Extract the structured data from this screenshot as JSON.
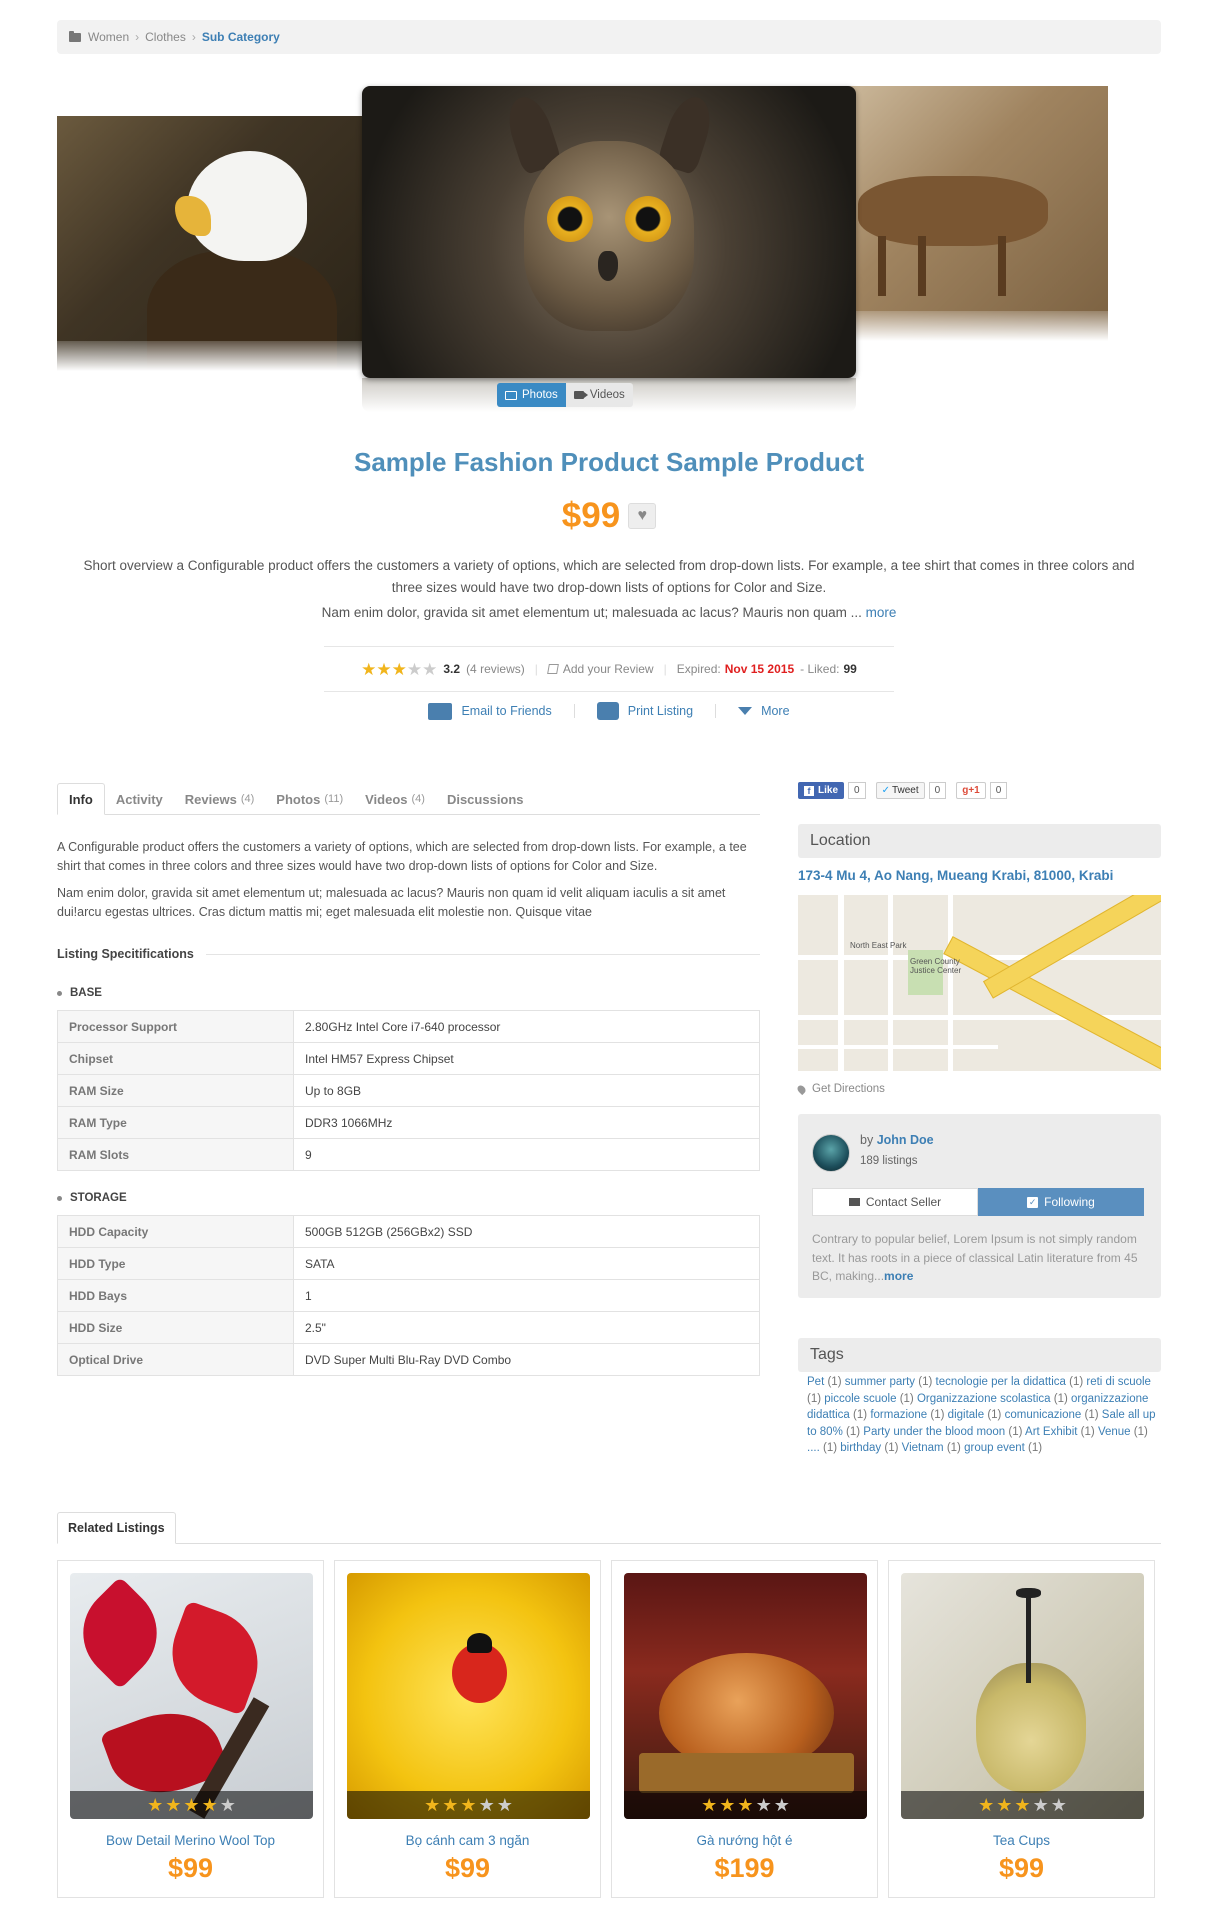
{
  "breadcrumb": {
    "items": [
      "Women",
      "Clothes"
    ],
    "current": "Sub Category"
  },
  "gallery": {
    "tabs": [
      {
        "label": "Photos",
        "icon": "photo-icon"
      },
      {
        "label": "Videos",
        "icon": "video-icon"
      }
    ]
  },
  "product": {
    "title": "Sample Fashion Product Sample Product",
    "price": "$99",
    "overview": "Short overview a Configurable product offers the customers a variety of options, which are selected from drop-down lists. For example, a tee shirt that comes in three colors and three sizes would have two drop-down lists of options for Color and Size.",
    "overview2": "Nam enim dolor, gravida sit amet elementum ut; malesuada ac lacus? Mauris non quam ... ",
    "more": "more",
    "rating": "3.2",
    "rating_stars": 3,
    "reviews": "(4 reviews)",
    "add_review": "Add your Review",
    "expired_label": "Expired:",
    "expired_date": "Nov 15 2015",
    "liked_label": "- Liked:",
    "liked": "99"
  },
  "actions": {
    "email": "Email to Friends",
    "print": "Print Listing",
    "more": "More"
  },
  "tabs": [
    {
      "label": "Info",
      "count": ""
    },
    {
      "label": "Activity",
      "count": ""
    },
    {
      "label": "Reviews",
      "count": "(4)"
    },
    {
      "label": "Photos",
      "count": "(11)"
    },
    {
      "label": "Videos",
      "count": "(4)"
    },
    {
      "label": "Discussions",
      "count": ""
    }
  ],
  "info": {
    "p1": "A Configurable product offers the customers a variety of options, which are selected from drop-down lists. For example, a tee shirt that comes in three colors and three sizes would have two drop-down lists of options for Color and Size.",
    "p2": "Nam enim dolor, gravida sit amet elementum ut; malesuada ac lacus? Mauris non quam id velit aliquam iaculis a sit amet dui!arcu egestas ultrices. Cras dictum mattis mi; eget malesuada elit molestie non. Quisque vitae"
  },
  "specs": {
    "title": "Listing Specitifications",
    "base_label": "BASE",
    "base": [
      {
        "k": "Processor Support",
        "v": "2.80GHz Intel Core i7-640 processor"
      },
      {
        "k": "Chipset",
        "v": "Intel HM57 Express Chipset"
      },
      {
        "k": "RAM Size",
        "v": "Up to 8GB"
      },
      {
        "k": "RAM Type",
        "v": "DDR3 1066MHz"
      },
      {
        "k": "RAM Slots",
        "v": "9"
      }
    ],
    "storage_label": "STORAGE",
    "storage": [
      {
        "k": "HDD Capacity",
        "v": "500GB 512GB (256GBx2) SSD"
      },
      {
        "k": "HDD Type",
        "v": "SATA"
      },
      {
        "k": "HDD Bays",
        "v": "1"
      },
      {
        "k": "HDD Size",
        "v": "2.5\""
      },
      {
        "k": "Optical Drive",
        "v": "DVD Super Multi Blu-Ray DVD Combo"
      }
    ]
  },
  "social": {
    "fb_label": "Like",
    "fb_count": "0",
    "tw_label": "Tweet",
    "tw_count": "0",
    "gp_label": "+1",
    "gp_count": "0"
  },
  "location": {
    "heading": "Location",
    "address": "173-4 Mu 4, Ao Nang, Mueang Krabi, 81000, Krabi",
    "directions": "Get Directions",
    "map_labels": [
      "North East Park",
      "Green County Justice Center"
    ]
  },
  "seller": {
    "by": "by",
    "name": "John Doe",
    "listings": "189 listings",
    "contact": "Contact Seller",
    "following": "Following",
    "desc": "Contrary to popular belief, Lorem Ipsum is not simply random text. It has roots in a piece of classical Latin literature from 45 BC, making...",
    "more": "more"
  },
  "tags": {
    "heading": "Tags",
    "items": [
      {
        "name": "Pet",
        "count": "(1)"
      },
      {
        "name": "summer party",
        "count": "(1)"
      },
      {
        "name": "tecnologie per la didattica",
        "count": "(1)"
      },
      {
        "name": "reti di scuole",
        "count": "(1)"
      },
      {
        "name": "piccole scuole",
        "count": "(1)"
      },
      {
        "name": "Organizzazione scolastica",
        "count": "(1)"
      },
      {
        "name": "organizzazione didattica",
        "count": "(1)"
      },
      {
        "name": "formazione",
        "count": "(1)"
      },
      {
        "name": "digitale",
        "count": "(1)"
      },
      {
        "name": "comunicazione",
        "count": "(1)"
      },
      {
        "name": "Sale all up to 80%",
        "count": "(1)"
      },
      {
        "name": "Party under the blood moon",
        "count": "(1)"
      },
      {
        "name": "Art Exhibit",
        "count": "(1)"
      },
      {
        "name": "Venue",
        "count": "(1)"
      },
      {
        "name": "....",
        "count": "(1)"
      },
      {
        "name": "birthday",
        "count": "(1)"
      },
      {
        "name": "Vietnam",
        "count": "(1)"
      },
      {
        "name": "group event",
        "count": "(1)"
      }
    ]
  },
  "related": {
    "heading": "Related Listings",
    "items": [
      {
        "name": "Bow Detail Merino Wool Top",
        "price": "$99",
        "stars": 4
      },
      {
        "name": "Bọ cánh cam 3 ngăn",
        "price": "$99",
        "stars": 3
      },
      {
        "name": "Gà nướng hột é",
        "price": "$199",
        "stars": 3
      },
      {
        "name": "Tea Cups",
        "price": "$99",
        "stars": 3
      }
    ]
  },
  "colors": {
    "accent": "#3d7fb4",
    "price": "#f7941d",
    "expired": "#e01f1f",
    "star": "#f1b51c"
  }
}
